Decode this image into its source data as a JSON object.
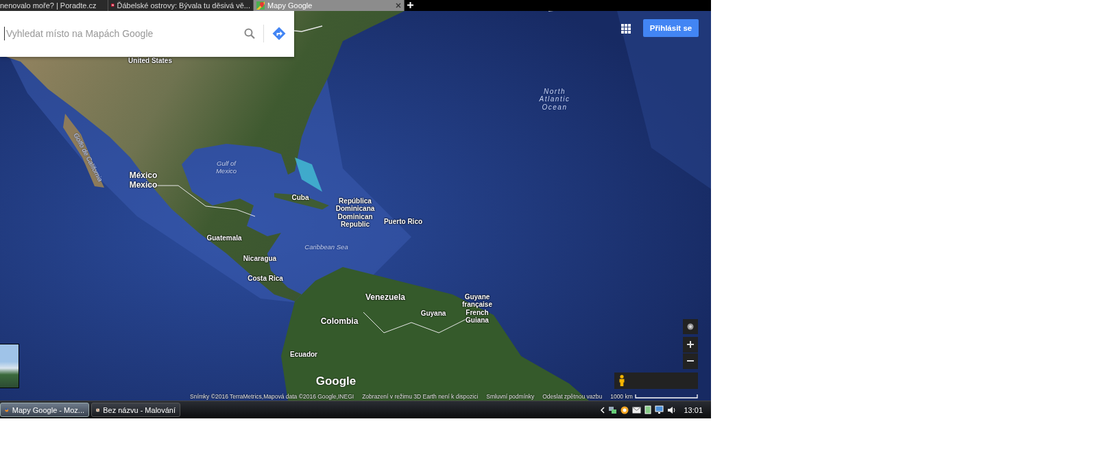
{
  "browser_tabs": [
    {
      "label": "nenovalo moře? | Poradte.cz",
      "selected": false
    },
    {
      "label": "Ďábelské ostrovy: Bývala tu děsivá vě...",
      "selected": false
    },
    {
      "label": "Mapy Google",
      "selected": true
    }
  ],
  "search": {
    "placeholder": "Vyhledat místo na Mapách Google"
  },
  "sign_in_button": "Přihlásit se",
  "map_labels": [
    {
      "text": "United States",
      "kind": "country"
    },
    {
      "text": "Golfo de California",
      "kind": "water"
    },
    {
      "text": "México\nMexico",
      "kind": "country"
    },
    {
      "text": "Gulf of\nMexico",
      "kind": "water"
    },
    {
      "text": "Cuba",
      "kind": "country"
    },
    {
      "text": "República\nDominicana\nDominican\nRepublic",
      "kind": "country"
    },
    {
      "text": "Puerto Rico",
      "kind": "country"
    },
    {
      "text": "Caribbean Sea",
      "kind": "water"
    },
    {
      "text": "Guatemala",
      "kind": "country"
    },
    {
      "text": "Nicaragua",
      "kind": "country"
    },
    {
      "text": "Costa Rica",
      "kind": "country"
    },
    {
      "text": "Venezuela",
      "kind": "country"
    },
    {
      "text": "Colombia",
      "kind": "country"
    },
    {
      "text": "Guyana",
      "kind": "country"
    },
    {
      "text": "Guyane\nfrançaise\nFrench\nGuiana",
      "kind": "country"
    },
    {
      "text": "Ecuador",
      "kind": "country"
    },
    {
      "text": "North\nAtlantic\nOcean",
      "kind": "ocean"
    }
  ],
  "map_logo": "Google",
  "attribution": [
    "Snímky ©2016 TerraMetrics,Mapová data ©2016 Google,INEGI",
    "Zobrazení v režimu 3D Earth není k dispozici",
    "Smluvní podmínky",
    "Odeslat zpětnou vazbu"
  ],
  "scale": {
    "label": "1000 km"
  },
  "taskbar": {
    "windows": [
      {
        "label": "Mapy Google - Moz...",
        "selected": true
      },
      {
        "label": "Bez názvu - Malování",
        "selected": false
      }
    ],
    "clock": "13:01"
  }
}
